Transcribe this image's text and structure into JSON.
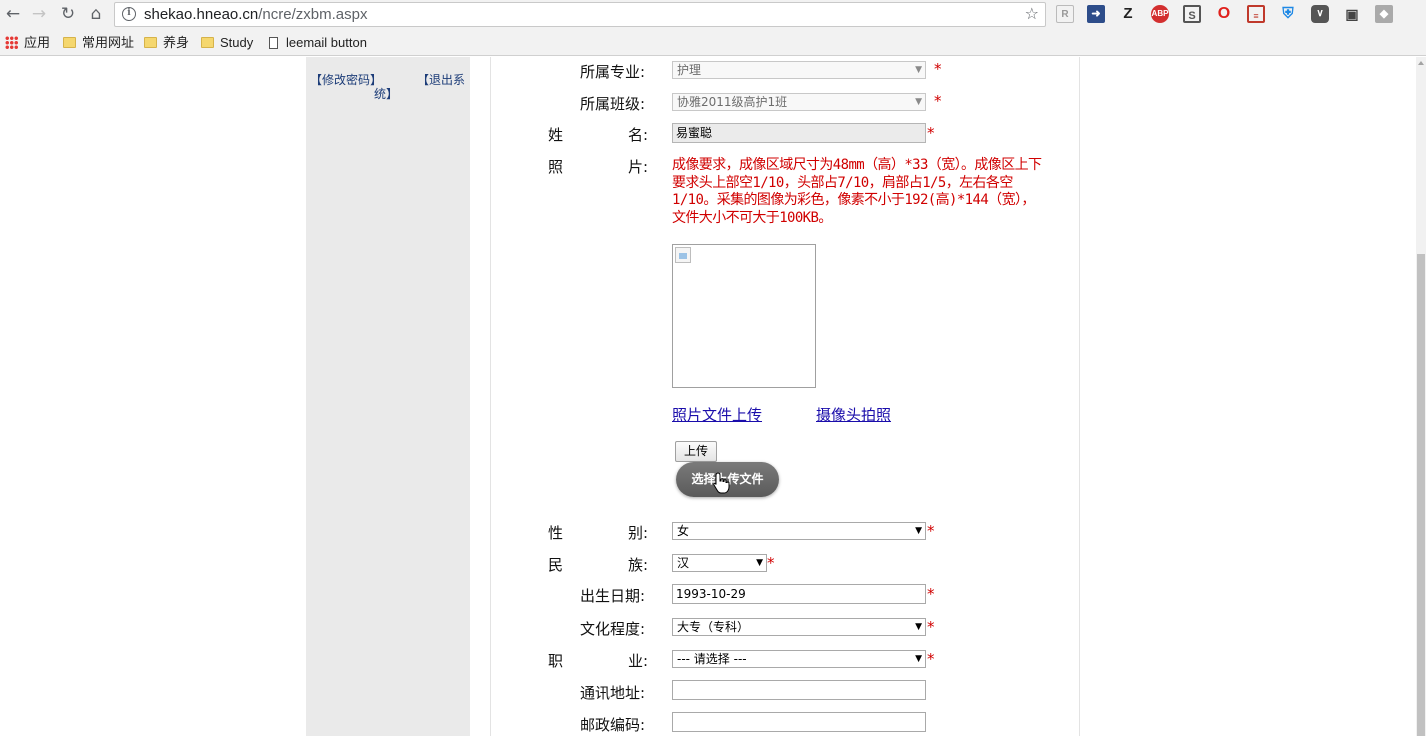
{
  "browser": {
    "url_host": "shekao.hneao.cn",
    "url_path": "/ncre/zxbm.aspx",
    "bookmarks": [
      {
        "label": "应用",
        "type": "apps"
      },
      {
        "label": "常用网址",
        "type": "folder"
      },
      {
        "label": "养身",
        "type": "folder"
      },
      {
        "label": "Study",
        "type": "folder"
      },
      {
        "label": "leemail button",
        "type": "page"
      }
    ],
    "extensions": [
      "R",
      "arrow-icon",
      "Z",
      "ABP",
      "S",
      "opera-icon",
      "notes-icon",
      "shield-icon",
      "pocket-icon",
      "puzzle-icon",
      "diamond-icon"
    ]
  },
  "sidebar": {
    "change_password": "【修改密码】",
    "logout_line1": "【退出系",
    "logout_line2": "统】"
  },
  "form": {
    "major": {
      "label": "所属专业:",
      "value": "护理"
    },
    "class": {
      "label": "所属班级:",
      "value": "协雅2011级高护1班"
    },
    "name": {
      "label_a": "姓",
      "label_b": "名:",
      "value": "易蜜聪"
    },
    "photo": {
      "label_a": "照",
      "label_b": "片:",
      "notice": "成像要求，成像区域尺寸为48mm（高）*33（宽）。成像区上下要求头上部空1/10，头部占7/10，肩部占1/5，左右各空1/10。采集的图像为彩色，像素不小于192(高)*144（宽），文件大小不可大于100KB。",
      "upload_file_link": "照片文件上传",
      "camera_link": "摄像头拍照",
      "upload_button": "上传",
      "choose_file_button": "选择上传文件"
    },
    "gender": {
      "label_a": "性",
      "label_b": "别:",
      "value": "女"
    },
    "ethnicity": {
      "label_a": "民",
      "label_b": "族:",
      "value": "汉"
    },
    "birth_date": {
      "label": "出生日期:",
      "value": "1993-10-29"
    },
    "education": {
      "label": "文化程度:",
      "value": "大专（专科）"
    },
    "occupation": {
      "label_a": "职",
      "label_b": "业:",
      "value": "--- 请选择 ---"
    },
    "address": {
      "label": "通讯地址:",
      "value": ""
    },
    "postcode": {
      "label": "邮政编码:",
      "value": ""
    },
    "required_mark": "*"
  }
}
